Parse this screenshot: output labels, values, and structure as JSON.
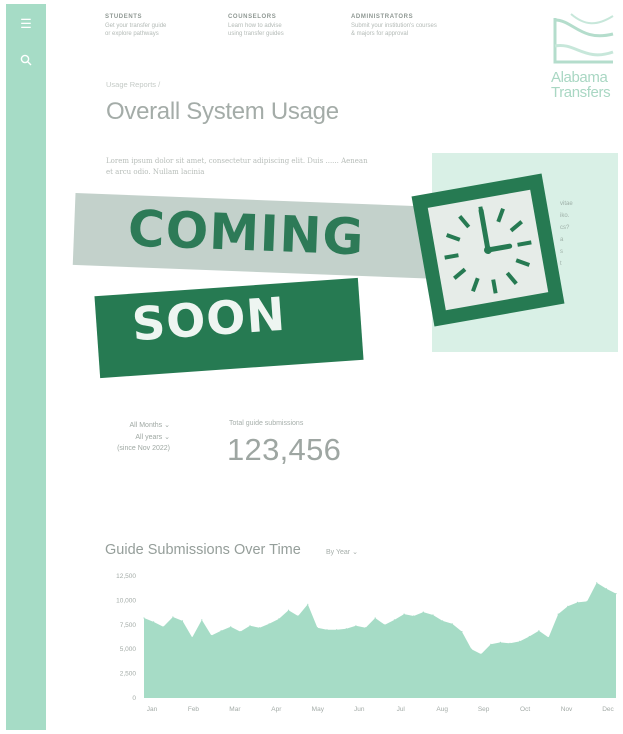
{
  "sidebar": {
    "icons": [
      "menu-icon",
      "search-icon"
    ]
  },
  "nav": [
    {
      "title": "STUDENTS",
      "desc": "Get your transfer guide\nor explore pathways"
    },
    {
      "title": "COUNSELORS",
      "desc": "Learn how to advise\nusing transfer guides"
    },
    {
      "title": "ADMINISTRATORS",
      "desc": "Submit your institution's courses\n& majors for approval"
    }
  ],
  "logo": {
    "line1": "Alabama",
    "line2": "Transfers"
  },
  "breadcrumb": "Usage Reports /",
  "page_title": "Overall System Usage",
  "lorem": "Lorem ipsum dolor sit amet, consectetur adipiscing elit. Duis ...... Aenean et arcu odio. Nullam lacinia",
  "panel_lines": [
    "vitae",
    "iko.",
    "cs?",
    "",
    "a",
    "s",
    "t"
  ],
  "overlay": {
    "coming": "COMING",
    "soon": "SOON"
  },
  "filters": {
    "months": "All Months ⌄",
    "years": "All years ⌄",
    "note": "(since Nov 2022)"
  },
  "total": {
    "label": "Total guide submissions",
    "value": "123,456"
  },
  "chart_header": {
    "title": "Guide Submissions Over Time",
    "period": "By Year ⌄"
  },
  "colors": {
    "accent": "#a6dcc6",
    "green": "#267a52",
    "band": "#c3d1cb",
    "panel": "#d9f0e6"
  },
  "chart_data": {
    "type": "area",
    "ylim": [
      0,
      12500
    ],
    "yticks": [
      "12,500",
      "10,000",
      "7,500",
      "5,000",
      "2,500",
      "0"
    ],
    "xticks": [
      "Jan",
      "Feb",
      "Mar",
      "Apr",
      "May",
      "Jun",
      "Jul",
      "Aug",
      "Sep",
      "Oct",
      "Nov",
      "Dec"
    ],
    "values": [
      8200,
      7800,
      7300,
      8300,
      7900,
      6200,
      8000,
      6400,
      6900,
      7300,
      6800,
      7400,
      7200,
      7600,
      8100,
      9000,
      8400,
      9600,
      7200,
      7000,
      7000,
      7100,
      7400,
      7200,
      8200,
      7500,
      8000,
      8600,
      8400,
      8800,
      8500,
      7900,
      7600,
      6800,
      5000,
      4500,
      5500,
      5700,
      5600,
      5800,
      6300,
      6900,
      6200,
      8600,
      9400,
      9800,
      9900,
      11800,
      11200,
      10700
    ]
  }
}
